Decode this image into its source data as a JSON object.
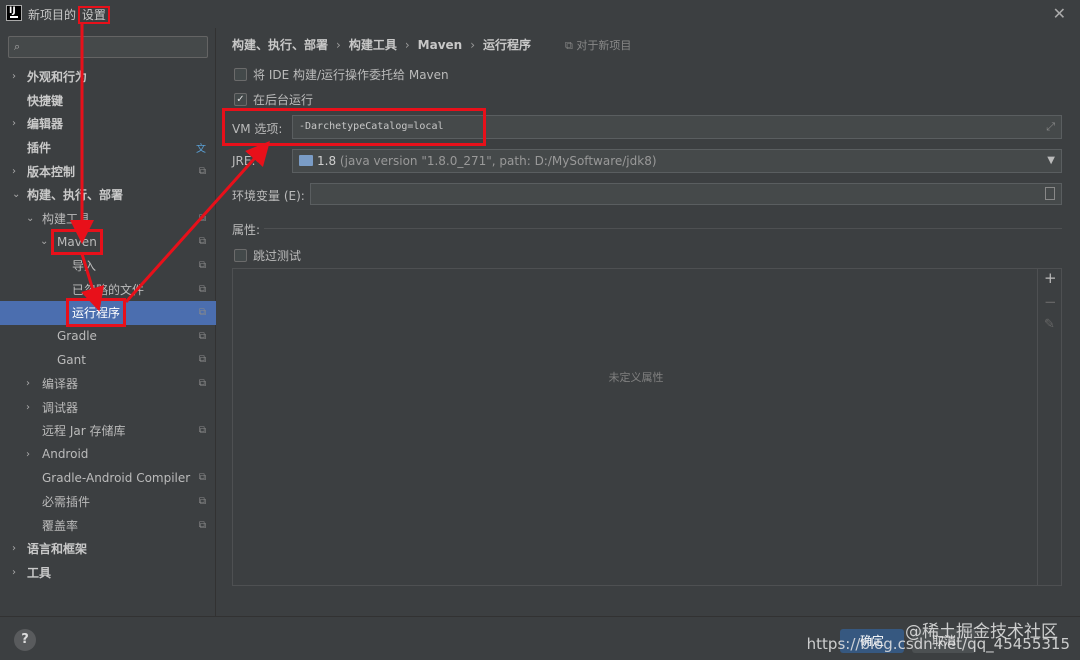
{
  "window": {
    "title_prefix": "新项目的",
    "title_highlight": "设置",
    "close_glyph": "✕"
  },
  "search": {
    "icon": "search-icon",
    "placeholder": ""
  },
  "tree": [
    {
      "id": "appearance",
      "label": "外观和行为",
      "arrow": "›",
      "indent": 0,
      "bold": true
    },
    {
      "id": "keymap",
      "label": "快捷键",
      "arrow": "",
      "indent": 0,
      "bold": true
    },
    {
      "id": "editor",
      "label": "编辑器",
      "arrow": "›",
      "indent": 0,
      "bold": true
    },
    {
      "id": "plugins",
      "label": "插件",
      "arrow": "",
      "indent": 0,
      "bold": true,
      "icon": "translate-icon"
    },
    {
      "id": "vcs",
      "label": "版本控制",
      "arrow": "›",
      "indent": 0,
      "bold": true,
      "icon": "copy-icon"
    },
    {
      "id": "build",
      "label": "构建、执行、部署",
      "arrow": "⌄",
      "indent": 0,
      "bold": true
    },
    {
      "id": "build-tools",
      "label": "构建工具",
      "arrow": "⌄",
      "indent": 1,
      "icon": "copy-icon"
    },
    {
      "id": "maven",
      "label": "Maven",
      "arrow": "⌄",
      "indent": 2,
      "icon": "copy-icon",
      "boxed": true
    },
    {
      "id": "import",
      "label": "导入",
      "arrow": "",
      "indent": 3,
      "icon": "copy-icon"
    },
    {
      "id": "ignored",
      "label": "已忽略的文件",
      "arrow": "",
      "indent": 3,
      "icon": "copy-icon"
    },
    {
      "id": "runner",
      "label": "运行程序",
      "arrow": "",
      "indent": 3,
      "icon": "copy-icon",
      "selected": true,
      "boxed": true
    },
    {
      "id": "gradle",
      "label": "Gradle",
      "arrow": "",
      "indent": 2,
      "icon": "copy-icon"
    },
    {
      "id": "gant",
      "label": "Gant",
      "arrow": "",
      "indent": 2,
      "icon": "copy-icon"
    },
    {
      "id": "compiler",
      "label": "编译器",
      "arrow": "›",
      "indent": 1,
      "icon": "copy-icon"
    },
    {
      "id": "debugger",
      "label": "调试器",
      "arrow": "›",
      "indent": 1
    },
    {
      "id": "remote-jar",
      "label": "远程 Jar 存储库",
      "arrow": "",
      "indent": 1,
      "icon": "copy-icon"
    },
    {
      "id": "android",
      "label": "Android",
      "arrow": "›",
      "indent": 1
    },
    {
      "id": "gradle-android",
      "label": "Gradle-Android Compiler",
      "arrow": "",
      "indent": 1,
      "icon": "copy-icon"
    },
    {
      "id": "required-plugins",
      "label": "必需插件",
      "arrow": "",
      "indent": 1,
      "icon": "copy-icon"
    },
    {
      "id": "coverage",
      "label": "覆盖率",
      "arrow": "",
      "indent": 1,
      "icon": "copy-icon"
    },
    {
      "id": "languages",
      "label": "语言和框架",
      "arrow": "›",
      "indent": 0,
      "bold": true
    },
    {
      "id": "tools",
      "label": "工具",
      "arrow": "›",
      "indent": 0,
      "bold": true
    }
  ],
  "breadcrumb": {
    "items": [
      "构建、执行、部署",
      "Maven",
      "运行程序"
    ],
    "first": "构建、执行、部署",
    "mid_tools": "构建工具",
    "mid_maven": "Maven",
    "last": "运行程序",
    "sep": "›",
    "project_scope": "⧉ 对于新项目"
  },
  "options": {
    "delegate_label": "将 IDE 构建/运行操作委托给 Maven",
    "delegate_checked": false,
    "background_label": "在后台运行",
    "background_checked": true,
    "check_glyph": "✓",
    "vm_label": "VM 选项:",
    "vm_value": "-DarchetypeCatalog=local",
    "jre_label": "JRE:",
    "jre_version": "1.8",
    "jre_detail": "(java version \"1.8.0_271\", path: D:/MySoftware/jdk8)",
    "env_label": "环境变量 (E):",
    "env_value": "",
    "properties_label": "属性:",
    "skip_tests_label": "跳过测试",
    "skip_tests_checked": false,
    "properties_empty": "未定义属性"
  },
  "side_tools": {
    "add": "+",
    "remove": "−",
    "edit": "✎"
  },
  "buttons": {
    "help": "?",
    "ok": "确定",
    "cancel": "取消"
  },
  "watermark": {
    "line1": "@稀土掘金技术社区",
    "line2": "https://blog.csdn.net/qq_45455315"
  },
  "annotation_color": "#e8101a"
}
